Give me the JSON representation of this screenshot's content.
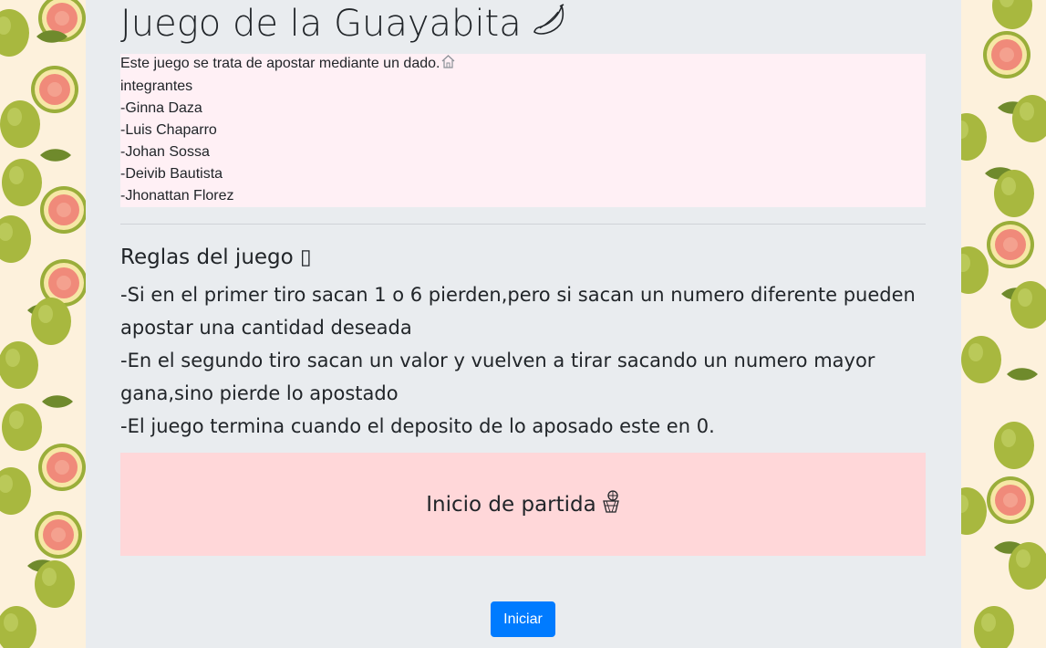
{
  "header": {
    "title": "Juego de la Guayabita",
    "title_icon": "banana-icon"
  },
  "info": {
    "description": "Este juego se trata de apostar mediante un dado.",
    "description_icon": "house-icon",
    "members_heading": "integrantes",
    "members": [
      "-Ginna Daza",
      "-Luis Chaparro",
      "-Johan Sossa",
      "-Deivib Bautista",
      "-Jhonattan Florez"
    ]
  },
  "rules": {
    "title": "Reglas del juego",
    "title_icon_glyph": "▯",
    "lines": [
      "-Si en el primer tiro sacan 1 o 6 pierden,pero si sacan un numero diferente pueden apostar una cantidad deseada",
      "-En el segundo tiro sacan un valor y vuelven a tirar sacando un numero mayor gana,sino pierde lo apostado",
      "-El juego termina cuando el deposito de lo aposado este en 0."
    ]
  },
  "start": {
    "label": "Inicio de partida",
    "label_icon": "basketball-hoop-icon",
    "button_label": "Iniciar"
  },
  "colors": {
    "page_background": "#fdf1dc",
    "container": "#e9ecef",
    "info_box": "#fff0f5",
    "start_box": "#ffd7d9",
    "button": "#007bff",
    "guava_green": "#a4b545",
    "guava_flesh": "#f08a7a"
  }
}
